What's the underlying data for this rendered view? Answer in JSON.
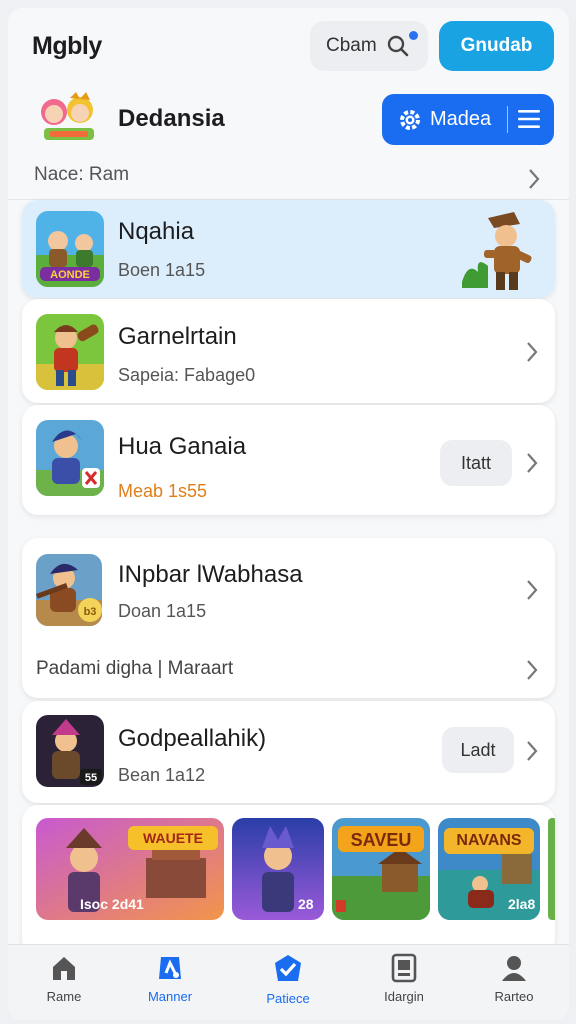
{
  "header": {
    "title": "Mgbly",
    "search_label": "Cbam",
    "primary_label": "Gnudab"
  },
  "brand": {
    "name": "Dedansia",
    "menu_label": "Madea"
  },
  "name_row": {
    "label": "Nace: Ram"
  },
  "items": [
    {
      "title": "Nqahia",
      "subtitle": "Boen 1a15"
    },
    {
      "title": "Garnelrtain",
      "subtitle": "Sapeia: Fabage0"
    },
    {
      "title": "Hua Ganaia",
      "subtitle": "Meab 1s55",
      "button": "Itatt"
    },
    {
      "title": "INpbar lWabhasa",
      "subtitle": "Doan 1a15"
    },
    {
      "title": "Godpeallahik)",
      "subtitle": "Bean 1a12",
      "button": "Ladt"
    }
  ],
  "group_row": {
    "label": "Padami digha | Maraart"
  },
  "tiles": [
    {
      "banner": "WAUETE",
      "label": "Isoc 2d41"
    },
    {
      "label": "28"
    },
    {
      "banner": "SAVEU",
      "label": ""
    },
    {
      "banner": "NAVANS",
      "label": "2la8"
    }
  ],
  "bottom_nav": [
    {
      "label": "Rame",
      "icon": "home-icon"
    },
    {
      "label": "Manner",
      "icon": "gamepad-icon"
    },
    {
      "label": "Patiece",
      "icon": "shield-check-icon"
    },
    {
      "label": "Idargin",
      "icon": "tablet-icon"
    },
    {
      "label": "Rarteo",
      "icon": "profile-icon"
    }
  ],
  "colors": {
    "accent": "#1a6cf0",
    "primary_button": "#1aa3e3",
    "selected_card": "#dceefc",
    "warning_text": "#e07e1a"
  }
}
